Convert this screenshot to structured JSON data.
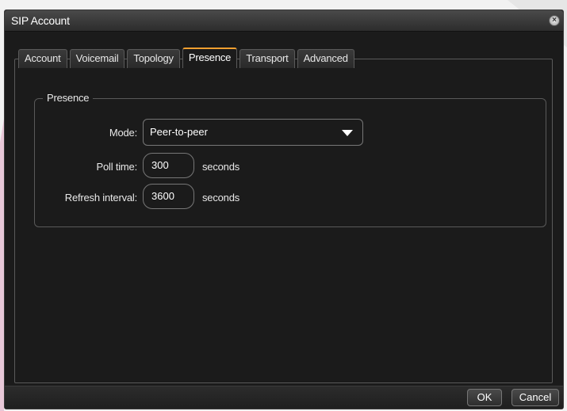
{
  "window": {
    "title": "SIP Account"
  },
  "tabs": [
    {
      "label": "Account"
    },
    {
      "label": "Voicemail"
    },
    {
      "label": "Topology"
    },
    {
      "label": "Presence",
      "active": true
    },
    {
      "label": "Transport"
    },
    {
      "label": "Advanced"
    }
  ],
  "presence": {
    "group_title": "Presence",
    "mode_label": "Mode:",
    "mode_value": "Peer-to-peer",
    "poll_label": "Poll time:",
    "poll_value": "300",
    "poll_unit": "seconds",
    "refresh_label": "Refresh interval:",
    "refresh_value": "3600",
    "refresh_unit": "seconds"
  },
  "footer": {
    "ok_label": "OK",
    "cancel_label": "Cancel"
  },
  "colors": {
    "accent": "#f0a030",
    "background": "#1b1b1b",
    "border": "#5a5a5a"
  }
}
